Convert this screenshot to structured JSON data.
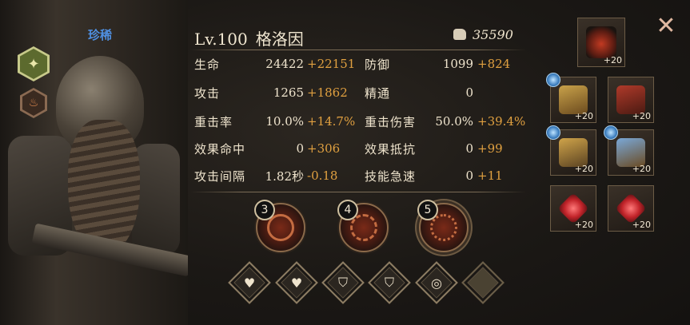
{
  "hero": {
    "rarity": "珍稀",
    "level": "Lv.100",
    "name": "格洛因",
    "power": "35590"
  },
  "stats": [
    {
      "label": "生命",
      "value": "24422",
      "bonus": "+22151"
    },
    {
      "label": "防御",
      "value": "1099",
      "bonus": "+824"
    },
    {
      "label": "攻击",
      "value": "1265",
      "bonus": "+1862"
    },
    {
      "label": "精通",
      "value": "0",
      "bonus": ""
    },
    {
      "label": "重击率",
      "value": "10.0%",
      "bonus": "+14.7%"
    },
    {
      "label": "重击伤害",
      "value": "50.0%",
      "bonus": "+39.4%"
    },
    {
      "label": "效果命中",
      "value": "0",
      "bonus": "+306"
    },
    {
      "label": "效果抵抗",
      "value": "0",
      "bonus": "+99"
    },
    {
      "label": "攻击间隔",
      "value": "1.82秒",
      "bonus": "-0.18"
    },
    {
      "label": "技能急速",
      "value": "0",
      "bonus": "+11"
    }
  ],
  "skills": [
    {
      "level": "3",
      "icon": "shield-skill-icon"
    },
    {
      "level": "4",
      "icon": "vortex-skill-icon"
    },
    {
      "level": "5",
      "icon": "burst-skill-icon"
    }
  ],
  "passives": [
    {
      "icon": "heart-icon",
      "glyph": "♥"
    },
    {
      "icon": "heart-heal-icon",
      "glyph": "♥"
    },
    {
      "icon": "shield-icon",
      "glyph": "⛉"
    },
    {
      "icon": "shield-icon",
      "glyph": "⛉"
    },
    {
      "icon": "swirl-icon",
      "glyph": "◎"
    },
    {
      "icon": "empty-slot",
      "glyph": ""
    }
  ],
  "equipment": [
    {
      "slot": "helmet",
      "level": "+20",
      "icon": "helmet-icon"
    },
    {
      "slot": "gauntlet-left",
      "level": "+20",
      "icon": "gauntlet-icon"
    },
    {
      "slot": "gauntlet-right",
      "level": "+20",
      "icon": "gauntlet-icon"
    },
    {
      "slot": "armor",
      "level": "+20",
      "icon": "armor-icon"
    },
    {
      "slot": "boot",
      "level": "+20",
      "icon": "boot-icon"
    },
    {
      "slot": "rune-left",
      "level": "+20",
      "icon": "rune-crystal-icon"
    },
    {
      "slot": "rune-right",
      "level": "+20",
      "icon": "rune-crystal-icon"
    }
  ],
  "close_icon": "close-icon",
  "colors": {
    "bonus": "#e0a040",
    "rarity": "#4f8fe0",
    "text": "#efe4cd"
  }
}
